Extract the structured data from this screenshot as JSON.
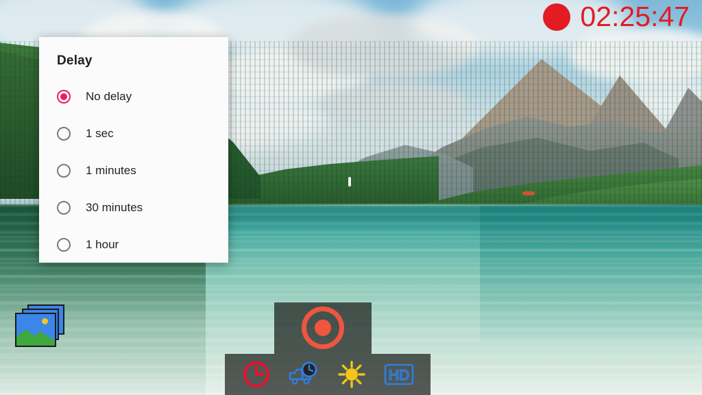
{
  "app": {
    "background_scene": "mountain-lake-landscape"
  },
  "recording": {
    "indicator_icon": "record-dot-icon",
    "elapsed_time": "02:25:47",
    "timer_color": "#e31b23"
  },
  "delay_dialog": {
    "title": "Delay",
    "selected_color": "#ec1d63",
    "options": [
      {
        "label": "No delay",
        "selected": true
      },
      {
        "label": "1 sec",
        "selected": false
      },
      {
        "label": "1 minutes",
        "selected": false
      },
      {
        "label": "30 minutes",
        "selected": false
      },
      {
        "label": "1 hour",
        "selected": false
      }
    ]
  },
  "gallery_button": {
    "icon": "gallery-photos-icon",
    "label": "Gallery"
  },
  "controls": {
    "record_button": {
      "icon": "record-circle-icon",
      "label": "Record",
      "color": "#f05540"
    },
    "tools": [
      {
        "name": "delay-timer",
        "icon": "clock-icon",
        "label": "Delay",
        "color": "#e8112d"
      },
      {
        "name": "time-lapse",
        "icon": "truck-clock-icon",
        "label": "Time lapse",
        "color": "#2f7fe0"
      },
      {
        "name": "brightness",
        "icon": "sun-icon",
        "label": "Brightness",
        "color": "#f5c518"
      },
      {
        "name": "video-quality",
        "icon": "hd-icon",
        "label": "HD",
        "color": "#2f7fe0"
      }
    ]
  }
}
